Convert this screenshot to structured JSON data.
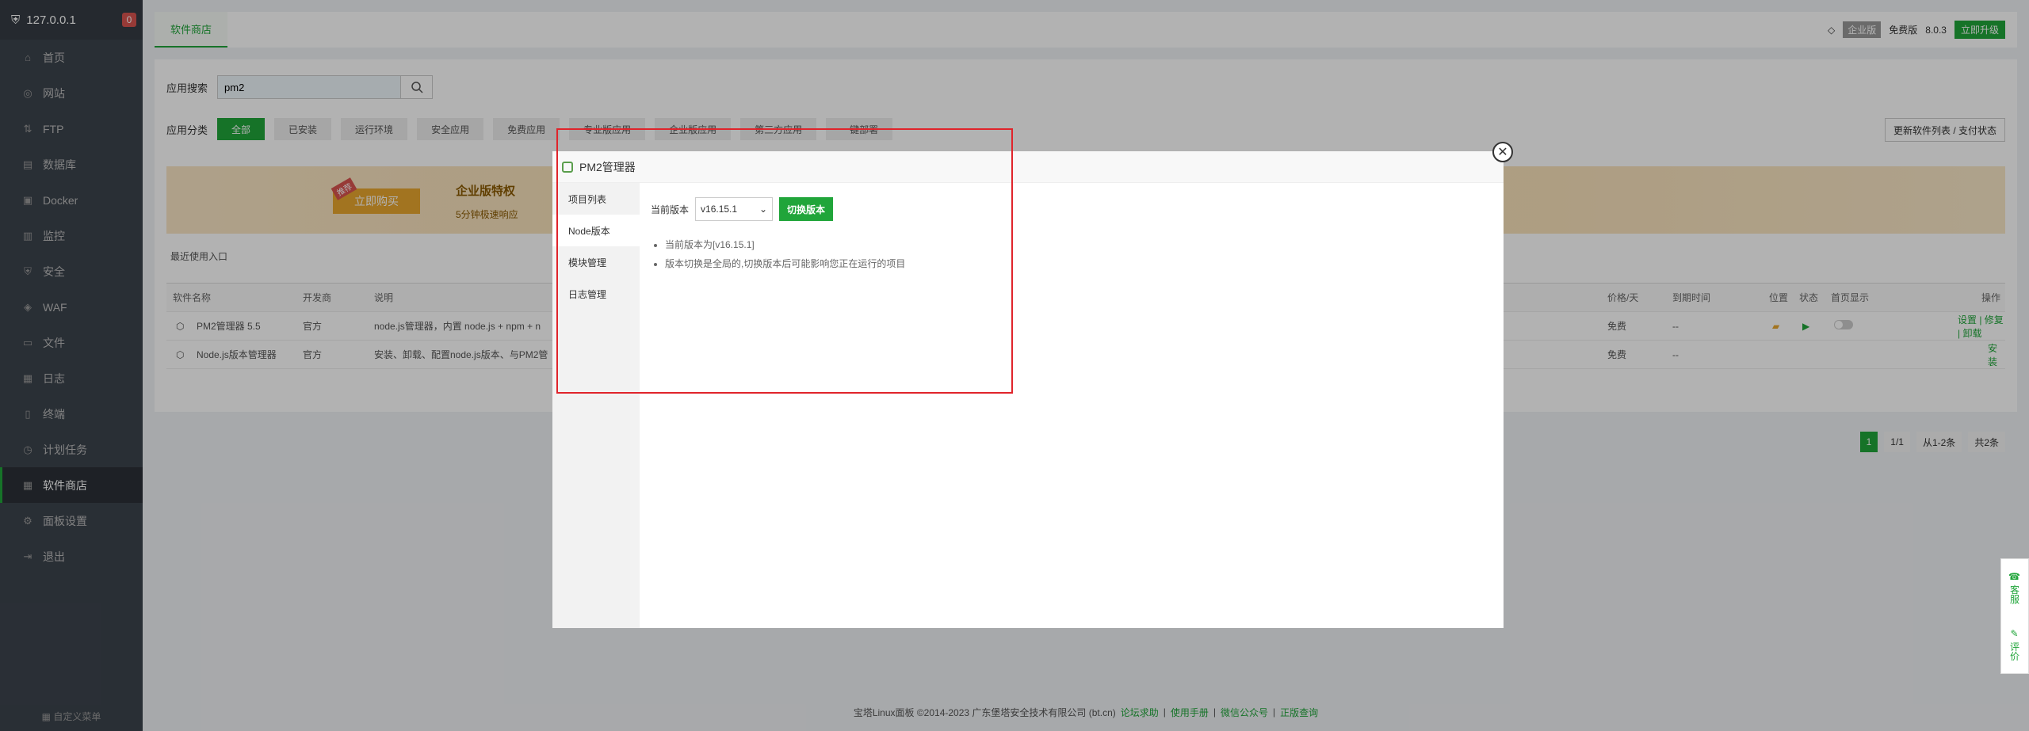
{
  "sidebar": {
    "host": "127.0.0.1",
    "badge": "0",
    "items": [
      {
        "label": "首页",
        "icon": "home-icon"
      },
      {
        "label": "网站",
        "icon": "globe-icon"
      },
      {
        "label": "FTP",
        "icon": "ftp-icon"
      },
      {
        "label": "数据库",
        "icon": "database-icon"
      },
      {
        "label": "Docker",
        "icon": "docker-icon"
      },
      {
        "label": "监控",
        "icon": "monitor-icon"
      },
      {
        "label": "安全",
        "icon": "shield-icon"
      },
      {
        "label": "WAF",
        "icon": "waf-icon"
      },
      {
        "label": "文件",
        "icon": "folder-icon"
      },
      {
        "label": "日志",
        "icon": "log-icon"
      },
      {
        "label": "终端",
        "icon": "terminal-icon"
      },
      {
        "label": "计划任务",
        "icon": "clock-icon"
      },
      {
        "label": "软件商店",
        "icon": "grid-icon"
      },
      {
        "label": "面板设置",
        "icon": "gear-icon"
      },
      {
        "label": "退出",
        "icon": "logout-icon"
      }
    ],
    "footer": "自定义菜单"
  },
  "topbar": {
    "tab": "软件商店",
    "edition_badge": "企业版",
    "edition": "免费版",
    "version": "8.0.3",
    "upgrade": "立即升级"
  },
  "search": {
    "label": "应用搜索",
    "value": "pm2"
  },
  "categories": {
    "label": "应用分类",
    "items": [
      "全部",
      "已安装",
      "运行环境",
      "安全应用",
      "免费应用",
      "专业版应用",
      "企业版应用",
      "第三方应用",
      "一键部署"
    ],
    "refresh": "更新软件列表 / 支付状态"
  },
  "banner": {
    "tag": "推荐",
    "buy": "立即购买",
    "title": "企业版特权",
    "subtitle": "5分钟极速响应"
  },
  "recent_label": "最近使用入口",
  "table": {
    "headers": {
      "name": "软件名称",
      "dev": "开发商",
      "desc": "说明",
      "price": "价格/天",
      "expire": "到期时间",
      "location": "位置",
      "status": "状态",
      "home": "首页显示",
      "ops": "操作"
    },
    "rows": [
      {
        "name": "PM2管理器 5.5",
        "dev": "官方",
        "desc": "node.js管理器，内置 node.js + npm + n",
        "price": "免费",
        "expire": "--",
        "ops": "设置 | 修复 | 卸载"
      },
      {
        "name": "Node.js版本管理器",
        "dev": "官方",
        "desc": "安装、卸载、配置node.js版本、与PM2管",
        "price": "免费",
        "expire": "--",
        "ops": "安装"
      }
    ]
  },
  "pager": {
    "current": "1",
    "pages": "1/1",
    "range": "从1-2条",
    "total": "共2条"
  },
  "footer": {
    "copyright": "宝塔Linux面板 ©2014-2023 广东堡塔安全技术有限公司 (bt.cn)",
    "links": [
      "论坛求助",
      "使用手册",
      "微信公众号",
      "正版查询"
    ]
  },
  "float": {
    "service": "客服",
    "review": "评价"
  },
  "modal": {
    "title": "PM2管理器",
    "menu": [
      "项目列表",
      "Node版本",
      "模块管理",
      "日志管理"
    ],
    "current_version_label": "当前版本",
    "current_version": "v16.15.1",
    "switch_button": "切换版本",
    "notes": [
      "当前版本为[v16.15.1]",
      "版本切换是全局的,切换版本后可能影响您正在运行的项目"
    ]
  },
  "colors": {
    "accent": "#20a53a",
    "sidebar": "#3c444d",
    "highlight": "#e0242b"
  }
}
